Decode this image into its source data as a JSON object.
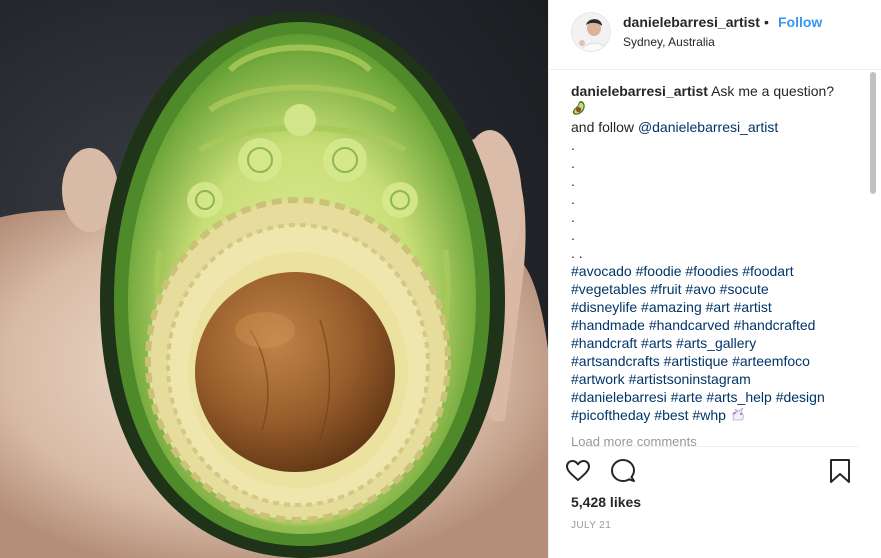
{
  "post": {
    "username": "danielebarresi_artist",
    "separator": "•",
    "follow_label": "Follow",
    "location": "Sydney, Australia"
  },
  "caption": {
    "username": "danielebarresi_artist",
    "text_1": "Ask me a question?",
    "text_2": "and follow",
    "mention": "@danielebarresi_artist",
    "dots": [
      ".",
      ".",
      ".",
      ".",
      ".",
      ".",
      ". ."
    ],
    "hashtag_lines": [
      "#avocado #foodie #foodies #foodart",
      "#vegetables #fruit #avo #socute",
      "#disneylife #amazing #art #artist",
      "#handmade #handcarved #handcrafted",
      "#handcraft #arts #arts_gallery",
      "#artsandcrafts #artistique #arteemfoco",
      "#artwork #artistsoninstagram",
      "#danielebarresi #arte #arts_help #design",
      "#picoftheday #best #whp"
    ]
  },
  "load_more_label": "Load more comments",
  "likes": "5,428 likes",
  "date": "JULY 21",
  "icons": [
    "heart-icon",
    "comment-icon",
    "bookmark-icon",
    "avocado-emoji",
    "unicorn-emoji"
  ],
  "colors": {
    "link": "#3897f0",
    "hashtag": "#003569",
    "muted": "#999999",
    "text": "#262626"
  }
}
